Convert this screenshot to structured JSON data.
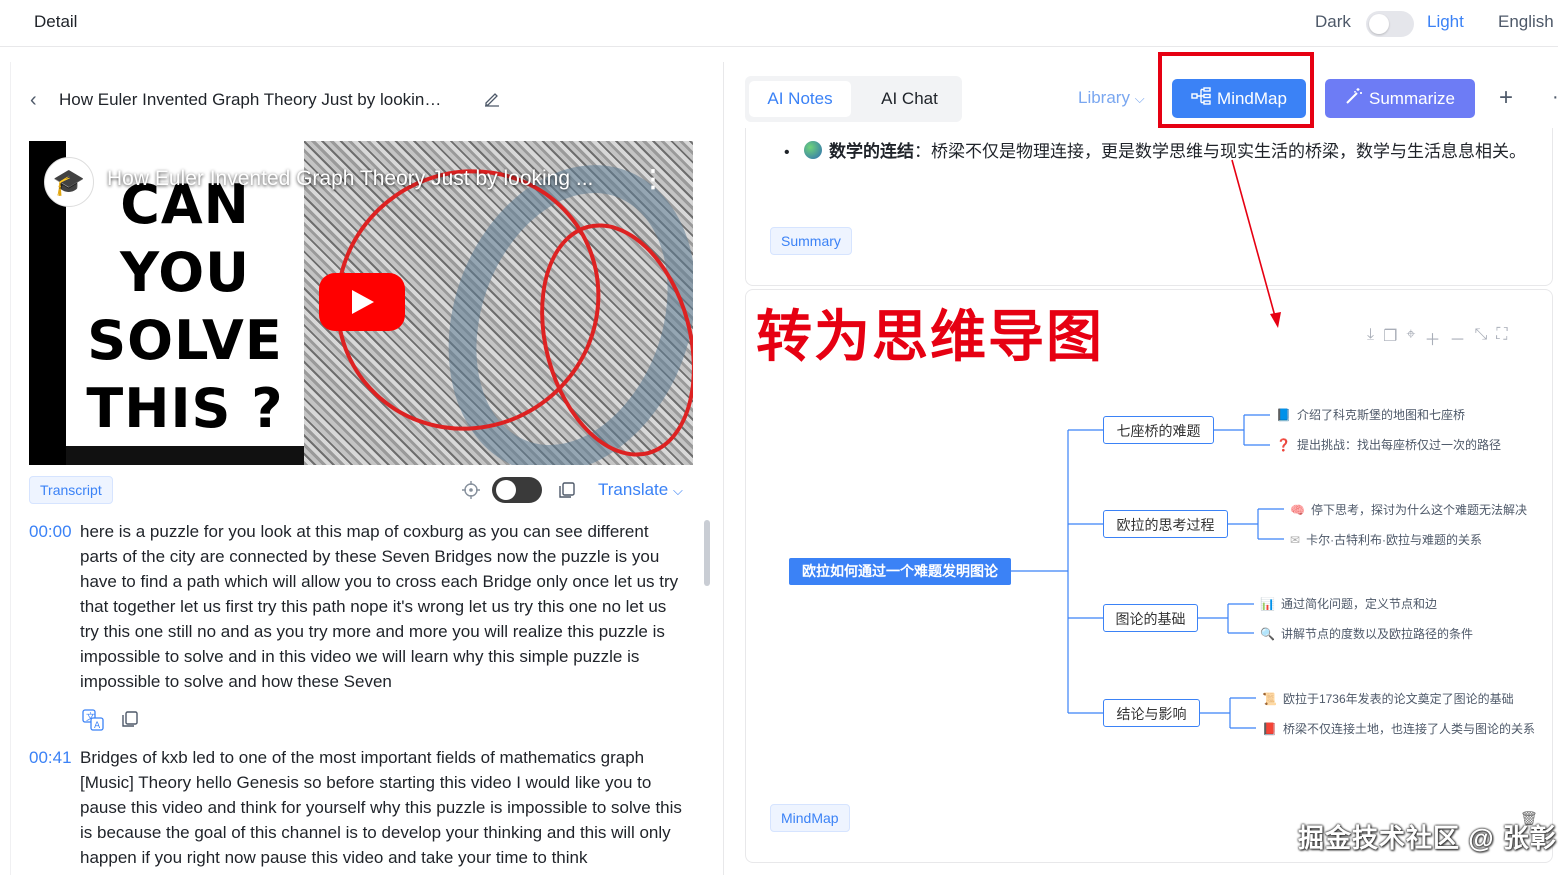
{
  "header": {
    "title": "Detail",
    "theme_dark": "Dark",
    "theme_light": "Light",
    "language": "English"
  },
  "video": {
    "title": "How Euler Invented Graph Theory Just by lookin…",
    "overlay_title": "How Euler Invented Graph Theory Just by looking ...",
    "thumbnail_text": "CAN YOU SOLVE THIS ?"
  },
  "transcript": {
    "tag": "Transcript",
    "translate": "Translate",
    "entries": [
      {
        "time": "00:00",
        "text": "here is a puzzle for you look at this map of coxburg as you can see different parts of the city are connected by these Seven Bridges now the puzzle is you have to find a path which will allow you to cross each Bridge only once let us try that together let us first try this path nope it's wrong let us try this one no let us try this one still no and as you try more and more you will realize this puzzle is impossible to solve and in this video we will learn why this simple puzzle is impossible to solve and how these Seven"
      },
      {
        "time": "00:41",
        "text": "Bridges of kxb led to one of the most important fields of mathematics graph [Music] Theory hello Genesis so before starting this video I would like you to pause this video and think for yourself why this puzzle is impossible to solve this is because the goal of this channel is to develop your thinking and this will only happen if you right now pause this video and take your time to think"
      }
    ]
  },
  "tabs": {
    "notes": "AI Notes",
    "chat": "AI Chat"
  },
  "toolbar": {
    "library": "Library",
    "mindmap": "MindMap",
    "summarize": "Summarize",
    "plus": "+"
  },
  "notes": {
    "heading": "数学的连结",
    "body": "：桥梁不仅是物理连接，更是数学思维与现实生活的桥梁，数学与生活息息相关。",
    "tag": "Summary"
  },
  "annotation": "转为思维导图",
  "mindmap": {
    "root": "欧拉如何通过一个难题发明图论",
    "branches": [
      {
        "label": "七座桥的难题",
        "leaves": [
          {
            "icon": "map-icon",
            "glyph": "📘",
            "text": "介绍了科克斯堡的地图和七座桥"
          },
          {
            "icon": "question-icon",
            "glyph": "❓",
            "text": "提出挑战：找出每座桥仅过一次的路径"
          }
        ]
      },
      {
        "label": "欧拉的思考过程",
        "leaves": [
          {
            "icon": "brain-icon",
            "glyph": "🧠",
            "text": "停下思考，探讨为什么这个难题无法解决"
          },
          {
            "icon": "mail-icon",
            "glyph": "✉",
            "text": "卡尔·古特利布·欧拉与难题的关系"
          }
        ]
      },
      {
        "label": "图论的基础",
        "leaves": [
          {
            "icon": "chart-icon",
            "glyph": "📊",
            "text": "通过简化问题，定义节点和边"
          },
          {
            "icon": "magnifier-icon",
            "glyph": "🔍",
            "text": "讲解节点的度数以及欧拉路径的条件"
          }
        ]
      },
      {
        "label": "结论与影响",
        "leaves": [
          {
            "icon": "scroll-icon",
            "glyph": "📜",
            "text": "欧拉于1736年发表的论文奠定了图论的基础"
          },
          {
            "icon": "book-icon",
            "glyph": "📕",
            "text": "桥梁不仅连接土地，也连接了人类与图论的关系"
          }
        ]
      }
    ],
    "tag": "MindMap"
  },
  "watermark": "掘金技术社区 @ 张彰",
  "colors": {
    "accent": "#3b82f6",
    "summarize": "#6d7cf5",
    "annotation_red": "#e60012"
  }
}
